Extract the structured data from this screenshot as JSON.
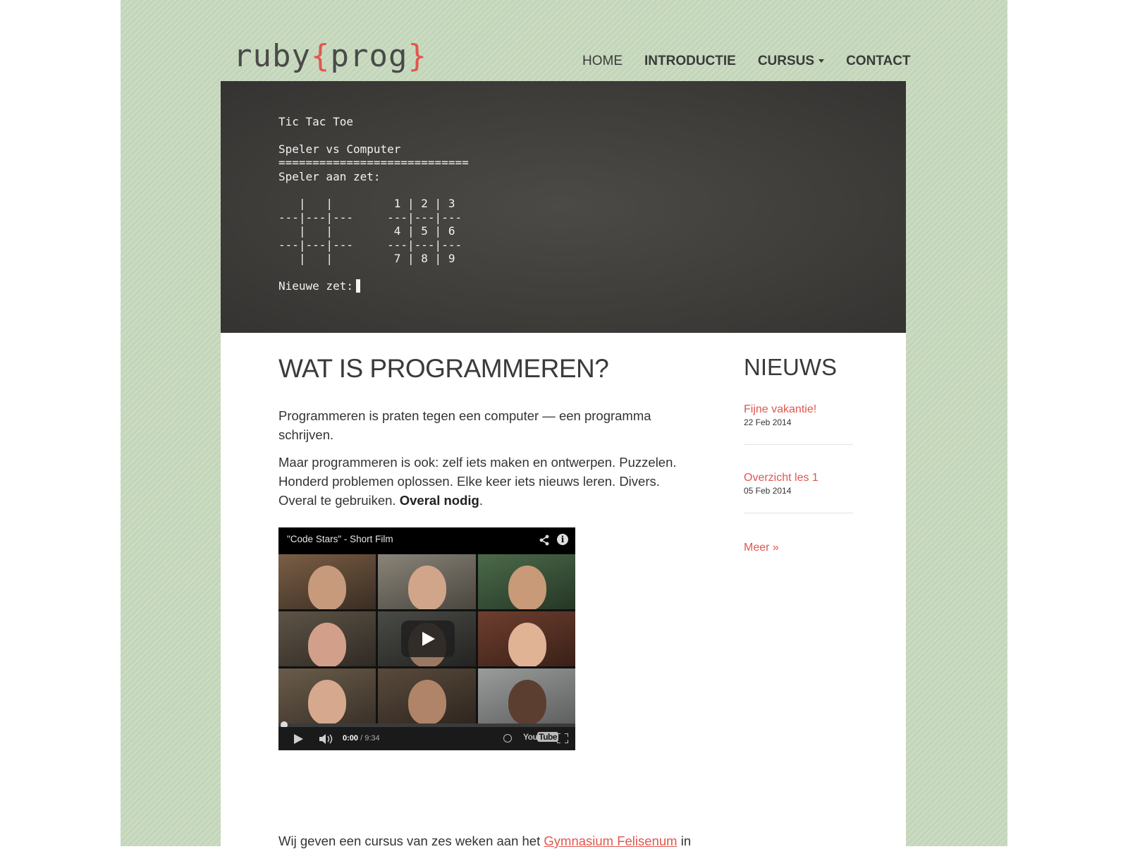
{
  "site": {
    "logo": {
      "word": "ruby",
      "open_brace": "{",
      "word2": "prog",
      "close_brace": "}"
    },
    "accent_color": "#e0574f",
    "background_color": "#c3d6b9"
  },
  "nav": {
    "items": [
      {
        "label": "HOME",
        "active": true
      },
      {
        "label": "INTRODUCTIE"
      },
      {
        "label": "CURSUS",
        "dropdown": true
      },
      {
        "label": "CONTACT"
      }
    ]
  },
  "terminal": {
    "lines": "Tic Tac Toe\n\nSpeler vs Computer\n============================\nSpeler aan zet:\n\n   |   |         1 | 2 | 3\n---|---|---     ---|---|---\n   |   |         4 | 5 | 6\n---|---|---     ---|---|---\n   |   |         7 | 8 | 9\n\nNieuwe zet:"
  },
  "main": {
    "title": "WAT IS PROGRAMMEREN?",
    "para1": "Programmeren is praten tegen een computer — een programma schrijven.",
    "para2_text": "Maar programmeren is ook: zelf iets maken en ontwerpen. Puzzelen. Honderd problemen oplossen. Elke keer iets nieuws leren. Divers. Overal te gebruiken. ",
    "para2_bold": "Overal nodig",
    "para2_end": ".",
    "bottom_text": "Wij geven een cursus van zes weken aan het ",
    "bottom_link": "Gymnasium Felisenum",
    "bottom_end": " in"
  },
  "video": {
    "title": "\"Code Stars\" - Short Film",
    "current_time": "0:00",
    "duration": "/ 9:34",
    "youtube_you": "You",
    "youtube_tube": "Tube",
    "progress": 0
  },
  "sidebar": {
    "title": "NIEUWS",
    "items": [
      {
        "title": "Fijne vakantie!",
        "date": "22 Feb 2014"
      },
      {
        "title": "Overzicht les 1",
        "date": "05 Feb 2014"
      }
    ],
    "more": "Meer »"
  }
}
